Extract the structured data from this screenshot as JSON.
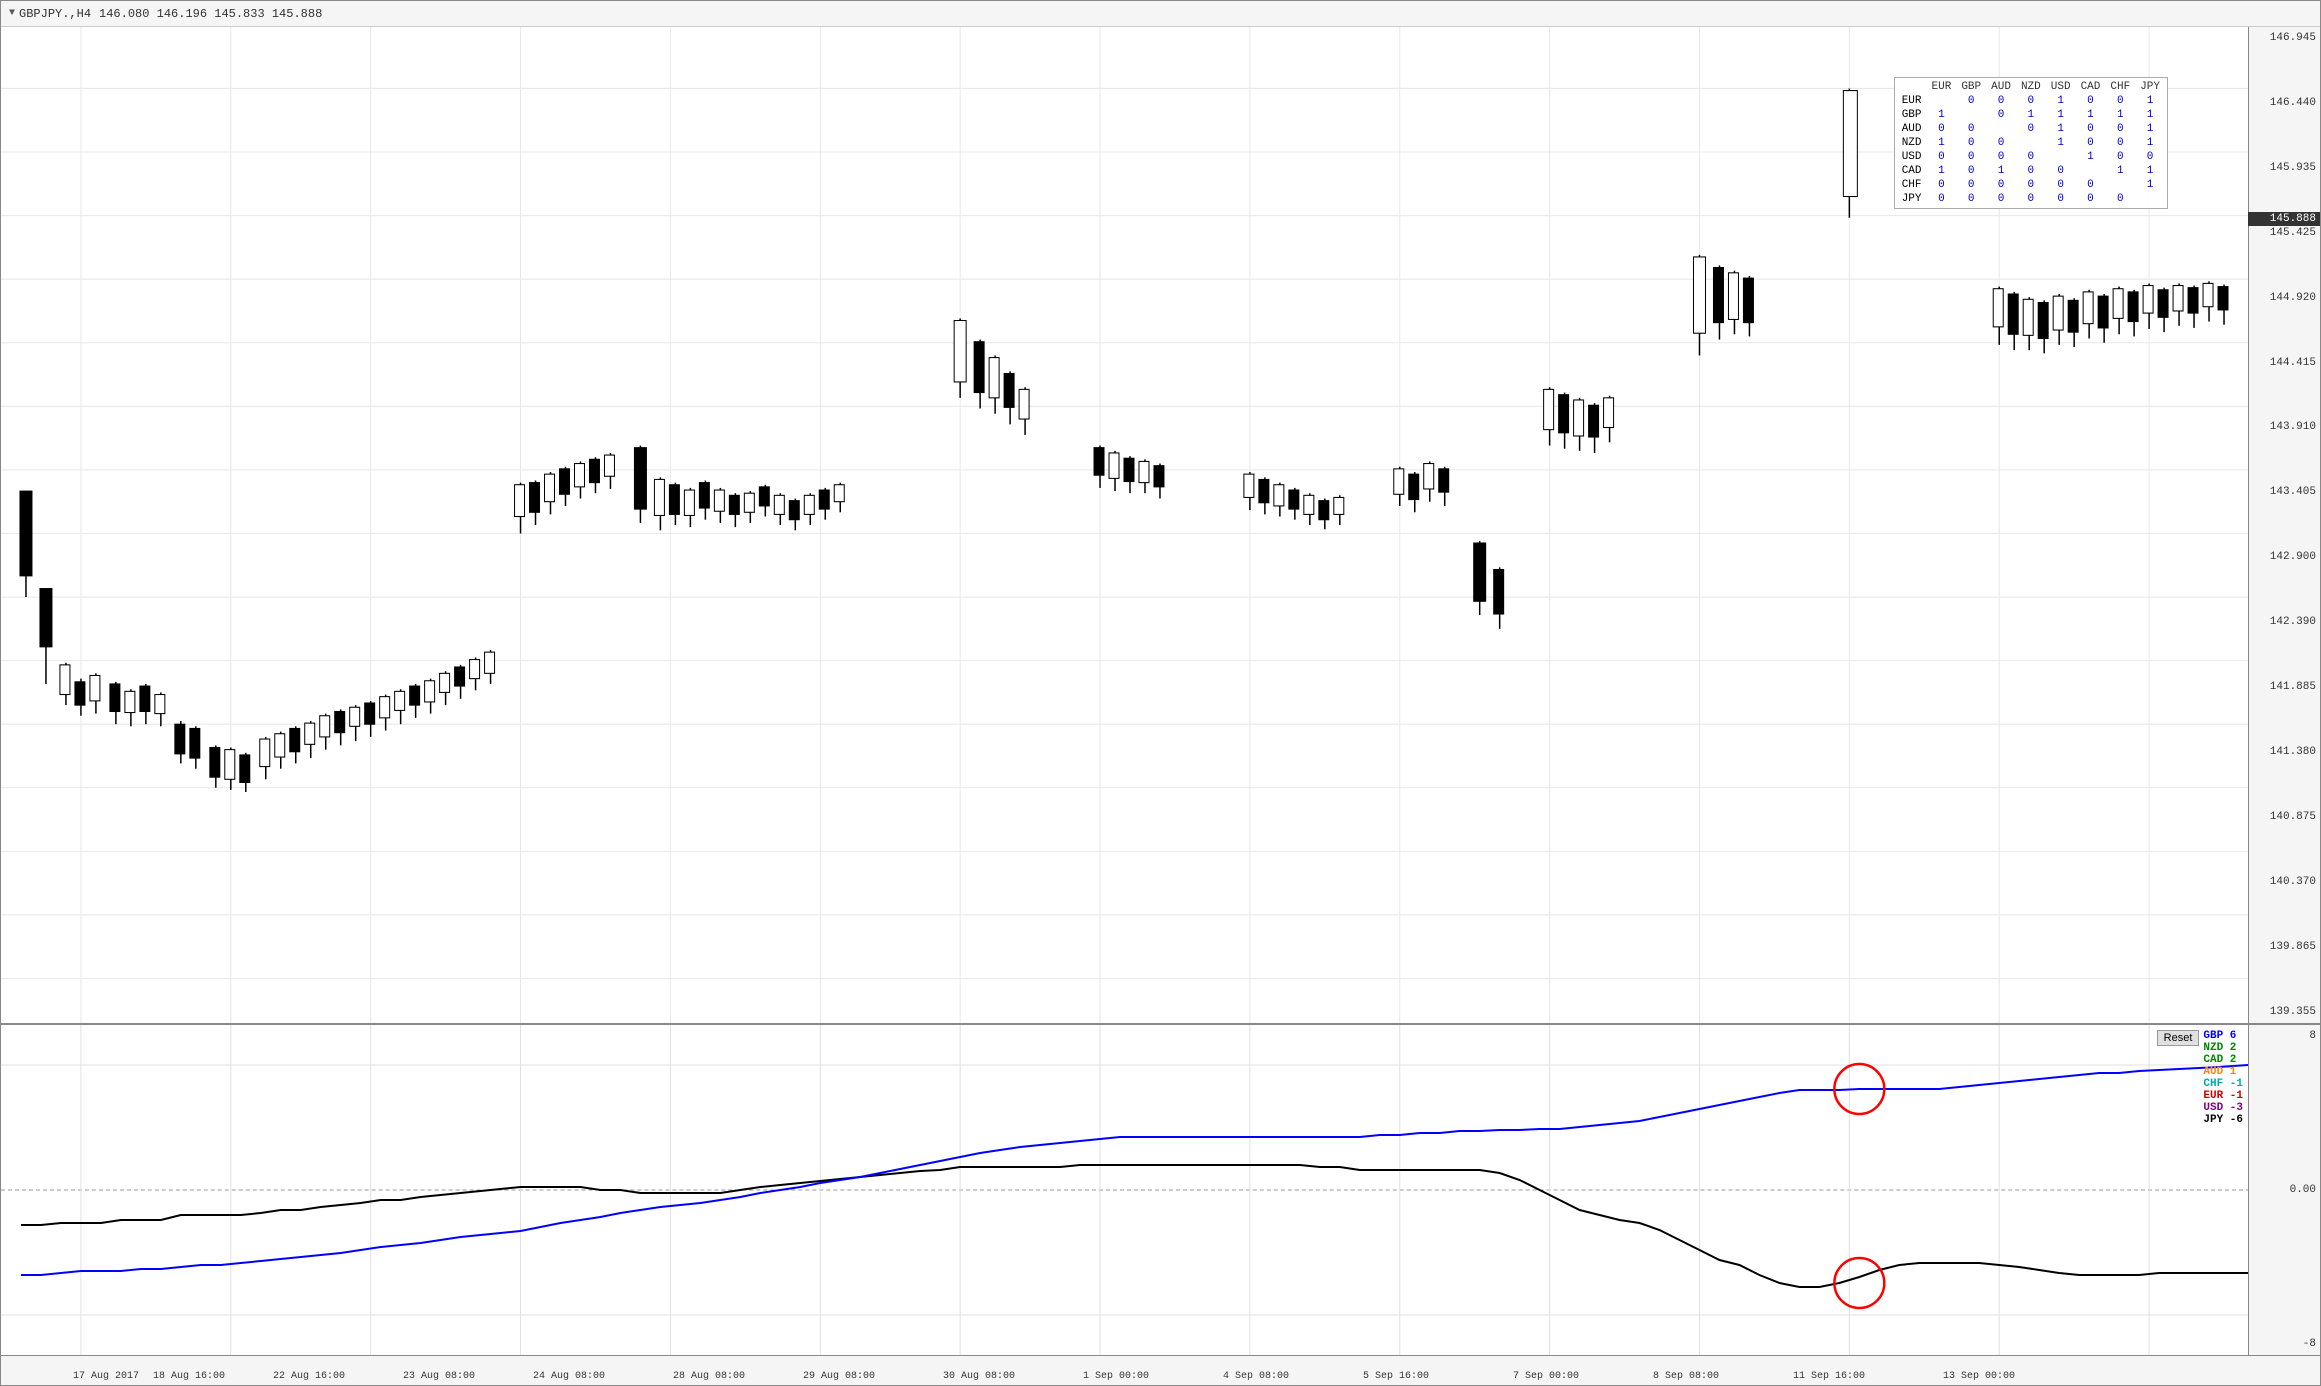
{
  "title": {
    "symbol": "GBPJPY.,H4",
    "ohlc": "146.080 146.196 145.833 145.888"
  },
  "price_axis": {
    "labels": [
      "146.945",
      "146.440",
      "145.935",
      "145.425",
      "144.920",
      "144.415",
      "143.910",
      "143.405",
      "142.900",
      "142.390",
      "141.885",
      "141.380",
      "140.875",
      "140.370",
      "139.865",
      "139.355"
    ],
    "current": "145.888"
  },
  "matrix": {
    "headers": [
      "EUR",
      "GBP",
      "AUD",
      "NZD",
      "USD",
      "CAD",
      "CHF",
      "JPY"
    ],
    "rows": [
      {
        "label": "EUR",
        "values": [
          "",
          "0",
          "0",
          "0",
          "1",
          "0",
          "0",
          "1"
        ]
      },
      {
        "label": "GBP",
        "values": [
          "1",
          "",
          "0",
          "1",
          "1",
          "1",
          "1",
          "1"
        ]
      },
      {
        "label": "AUD",
        "values": [
          "0",
          "0",
          "",
          "0",
          "1",
          "0",
          "0",
          "1"
        ]
      },
      {
        "label": "NZD",
        "values": [
          "1",
          "0",
          "0",
          "",
          "1",
          "0",
          "0",
          "1"
        ]
      },
      {
        "label": "USD",
        "values": [
          "0",
          "0",
          "0",
          "0",
          "",
          "1",
          "0",
          "0"
        ]
      },
      {
        "label": "CAD",
        "values": [
          "1",
          "0",
          "1",
          "0",
          "0",
          "",
          "1",
          "1"
        ]
      },
      {
        "label": "CHF",
        "values": [
          "0",
          "0",
          "0",
          "0",
          "0",
          "0",
          "",
          "1"
        ]
      },
      {
        "label": "JPY",
        "values": [
          "0",
          "0",
          "0",
          "0",
          "0",
          "0",
          "",
          ""
        ]
      }
    ]
  },
  "time_labels": [
    "17 Aug 2017",
    "18 Aug 16:00",
    "22 Aug 16:00",
    "23 Aug 08:00",
    "24 Aug 08:00",
    "28 Aug 08:00",
    "29 Aug 08:00",
    "30 Aug 08:00",
    "1 Sep 00:00",
    "4 Sep 08:00",
    "5 Sep 16:00",
    "7 Sep 00:00",
    "8 Sep 08:00",
    "11 Sep 16:00",
    "13 Sep 00:00"
  ],
  "indicator_axis": {
    "top": "8",
    "zero": "0.00",
    "bottom": "-8"
  },
  "legend": {
    "reset_label": "Reset",
    "items": [
      {
        "label": "GBP 6",
        "color": "#0000ff"
      },
      {
        "label": "NZD 2",
        "color": "#008800"
      },
      {
        "label": "CAD 2",
        "color": "#008800"
      },
      {
        "label": "AUD 1",
        "color": "#ff8800"
      },
      {
        "label": "CHF -1",
        "color": "#00aaaa"
      },
      {
        "label": "EUR -1",
        "color": "#cc0000"
      },
      {
        "label": "USD -3",
        "color": "#800080"
      },
      {
        "label": "JPY -6",
        "color": "#000000"
      }
    ]
  }
}
